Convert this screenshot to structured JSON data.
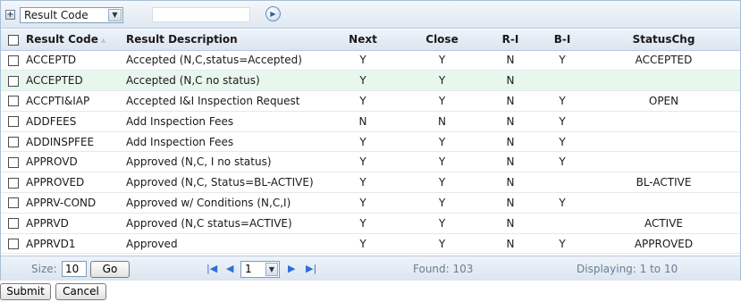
{
  "filter": {
    "field_selected": "Result Code",
    "value": "",
    "add_icon": "plus-square-icon",
    "go_icon": "arrow-right-circle-icon"
  },
  "columns": [
    "Result Code",
    "Result Description",
    "Next",
    "Close",
    "R-I",
    "B-I",
    "StatusChg"
  ],
  "rows": [
    [
      "ACCEPTD",
      "Accepted (N,C,status=Accepted)",
      "Y",
      "Y",
      "N",
      "Y",
      "ACCEPTED"
    ],
    [
      "ACCEPTED",
      "Accepted (N,C no status)",
      "Y",
      "Y",
      "N",
      "",
      ""
    ],
    [
      "ACCPTI&IAP",
      "Accepted I&I Inspection Request",
      "Y",
      "Y",
      "N",
      "Y",
      "OPEN"
    ],
    [
      "ADDFEES",
      "Add Inspection Fees",
      "N",
      "N",
      "N",
      "Y",
      ""
    ],
    [
      "ADDINSPFEE",
      "Add Inspection Fees",
      "Y",
      "Y",
      "N",
      "Y",
      ""
    ],
    [
      "APPROVD",
      "Approved (N,C, I no status)",
      "Y",
      "Y",
      "N",
      "Y",
      ""
    ],
    [
      "APPROVED",
      "Approved (N,C, Status=BL-ACTIVE)",
      "Y",
      "Y",
      "N",
      "",
      "BL-ACTIVE"
    ],
    [
      "APPRV-COND",
      "Approved w/ Conditions (N,C,I)",
      "Y",
      "Y",
      "N",
      "Y",
      ""
    ],
    [
      "APPRVD",
      "Approved (N,C status=ACTIVE)",
      "Y",
      "Y",
      "N",
      "",
      "ACTIVE"
    ],
    [
      "APPRVD1",
      "Approved",
      "Y",
      "Y",
      "N",
      "Y",
      "APPROVED"
    ]
  ],
  "highlighted_row": 1,
  "pager": {
    "size_label": "Size:",
    "size_value": "10",
    "go_label": "Go",
    "page_value": "1",
    "found_text": "Found: 103",
    "displaying_text": "Displaying: 1 to 10"
  },
  "actions": {
    "submit_label": "Submit",
    "cancel_label": "Cancel"
  },
  "colors": {
    "highlight_row": "#e8f7ee",
    "header_gradient_top": "#eef3f9",
    "nav_blue": "#2f6fd6"
  }
}
